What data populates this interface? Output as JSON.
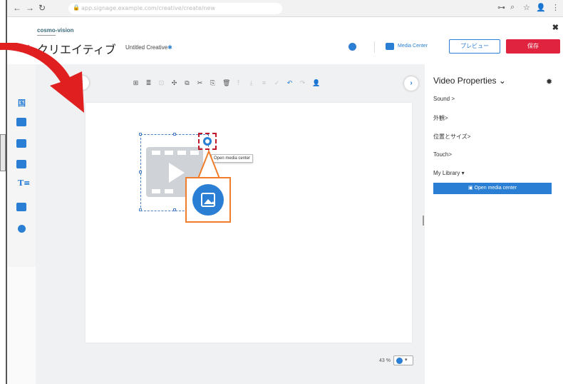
{
  "browser": {
    "url": "app.signage.example.com/creative/create/new"
  },
  "header": {
    "logo": "cosmo-vision",
    "title": "クリエイティブ",
    "subtitle": "Untitled Creative",
    "subtitle_star": "✱",
    "media_center": "Media Center",
    "preview": "プレビュー",
    "save": "保存",
    "close": "✖"
  },
  "toolbar": {
    "tools": [
      {
        "icon": "grid-icon",
        "glyph": "⊞",
        "state": "normal"
      },
      {
        "icon": "align-icon",
        "glyph": "≣",
        "state": "normal"
      },
      {
        "icon": "group-icon",
        "glyph": "⊡",
        "state": "dim"
      },
      {
        "icon": "move-icon",
        "glyph": "✣",
        "state": "normal"
      },
      {
        "icon": "copy-icon",
        "glyph": "⧉",
        "state": "normal"
      },
      {
        "icon": "cut-icon",
        "glyph": "✂",
        "state": "normal"
      },
      {
        "icon": "paste-icon",
        "glyph": "⎘",
        "state": "normal"
      },
      {
        "icon": "delete-icon",
        "glyph": "🗑",
        "state": "normal"
      },
      {
        "icon": "bring-forward-icon",
        "glyph": "⤒",
        "state": "dim"
      },
      {
        "icon": "send-backward-icon",
        "glyph": "⤓",
        "state": "dim"
      },
      {
        "icon": "layer-icon",
        "glyph": "≡",
        "state": "dim"
      },
      {
        "icon": "check-icon",
        "glyph": "✓",
        "state": "dim"
      },
      {
        "icon": "undo-icon",
        "glyph": "↶",
        "state": "blue"
      },
      {
        "icon": "redo-icon",
        "glyph": "↷",
        "state": "dim"
      },
      {
        "icon": "user-add-icon",
        "glyph": "👤",
        "state": "normal"
      }
    ]
  },
  "canvas": {
    "tooltip": "Open media center",
    "zoom": "43 %"
  },
  "panel": {
    "title": "Video Properties",
    "items": [
      "Sound >",
      "外観>",
      "位置とサイズ>",
      "Touch>",
      "My Library ▾"
    ],
    "button": "Open media center"
  },
  "colors": {
    "accent": "#2a7fd4",
    "save": "#e0233f",
    "callout": "#f07d2c",
    "arrow": "#e02020"
  }
}
